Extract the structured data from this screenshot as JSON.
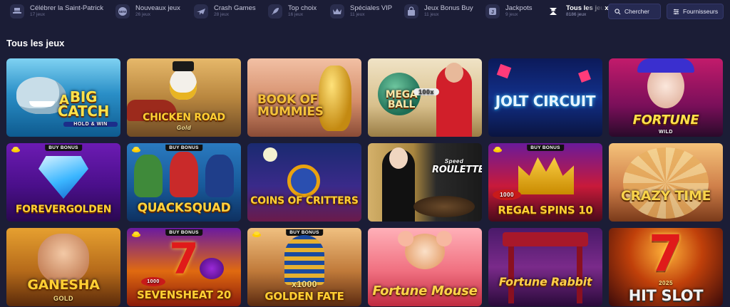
{
  "categories": [
    {
      "label": "Célébrer la Saint-Patrick",
      "count": "17 jeux",
      "icon": "clover-hat-icon"
    },
    {
      "label": "Nouveaux jeux",
      "count": "26 jeux",
      "icon": "new-badge-icon"
    },
    {
      "label": "Crash Games",
      "count": "28 jeux",
      "icon": "plane-icon"
    },
    {
      "label": "Top choix",
      "count": "16 jeux",
      "icon": "rocket-icon"
    },
    {
      "label": "Spéciales VIP",
      "count": "11 jeux",
      "icon": "crown-icon"
    },
    {
      "label": "Jeux Bonus Buy",
      "count": "11 jeux",
      "icon": "shopping-bag-icon"
    },
    {
      "label": "Jackpots",
      "count": "9 jeux",
      "icon": "jackpot-icon"
    },
    {
      "label": "Tous les jeux",
      "count": "8186 jeux",
      "icon": "all-games-icon"
    }
  ],
  "search": {
    "label": "Chercher"
  },
  "providers": {
    "label": "Fournisseurs"
  },
  "section": {
    "title": "Tous les jeux"
  },
  "badge_label": "BUY BONUS",
  "games": [
    {
      "title": "BIG CATCH",
      "subtitle": "HOLD & WIN",
      "prefix": "A"
    },
    {
      "title": "CHICKEN ROAD",
      "subtitle": "Gold"
    },
    {
      "title": "BOOK OF MUMMIES"
    },
    {
      "title": "MEGA BALL",
      "subtitle": "100x"
    },
    {
      "title": "JOLT CIRCUIT"
    },
    {
      "title": "FORTUNE",
      "subtitle": "WILD"
    },
    {
      "title": "FOREVERGOLDEN"
    },
    {
      "title": "QUACKSQUAD"
    },
    {
      "title": "COINS OF CRITTERS"
    },
    {
      "title": "ROULETTE",
      "subtitle": "Speed"
    },
    {
      "title": "REGAL SPINS 10",
      "subtitle": "1000"
    },
    {
      "title": "CRAZY TIME"
    },
    {
      "title": "GANESHA",
      "subtitle": "GOLD"
    },
    {
      "title": "SEVENSHEAT 20",
      "subtitle": "1000"
    },
    {
      "title": "GOLDEN FATE",
      "subtitle": "x1000"
    },
    {
      "title": "Fortune Mouse"
    },
    {
      "title": "Fortune Rabbit"
    },
    {
      "title": "HIT SLOT",
      "subtitle": "2025"
    }
  ],
  "colors": {
    "background": "#1b1d36",
    "accent": "#2a2d4d",
    "button": "#262a52"
  }
}
